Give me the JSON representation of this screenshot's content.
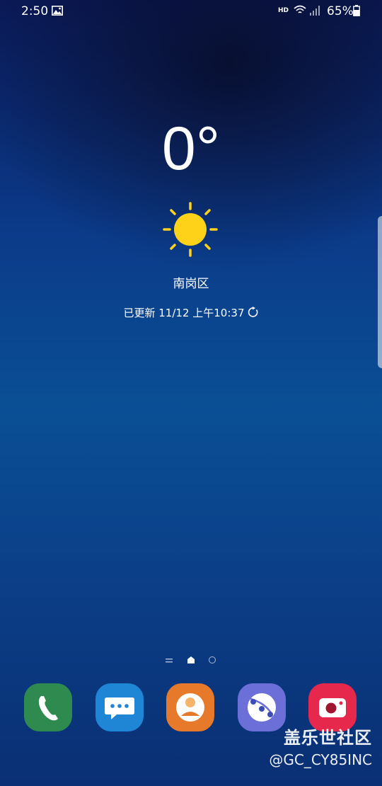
{
  "status_bar": {
    "time": "2:50",
    "network_label": "HD",
    "battery_percent": "65%",
    "icons": [
      "gallery-icon",
      "wifi-icon",
      "signal-icon",
      "battery-icon"
    ]
  },
  "weather_widget": {
    "temperature": "0°",
    "condition_icon": "sun-icon",
    "location": "南岗区",
    "updated": "已更新 11/12 上午10:37",
    "refresh_icon": "refresh-icon",
    "sun_color": "#FFD21A"
  },
  "page_indicator": {
    "items": [
      "pages-list-icon",
      "home-page-icon",
      "page-dot"
    ],
    "active": "home-page-icon"
  },
  "dock": {
    "apps": [
      {
        "name": "phone",
        "icon": "phone-icon",
        "color": "#2F8A4F"
      },
      {
        "name": "messages",
        "icon": "messages-icon",
        "color": "#1F86D6"
      },
      {
        "name": "contacts",
        "icon": "contacts-icon",
        "color": "#E67A2A"
      },
      {
        "name": "internet",
        "icon": "internet-icon",
        "color": "#6D6FD9"
      },
      {
        "name": "camera",
        "icon": "camera-icon",
        "color": "#E5284C"
      }
    ]
  },
  "watermark": {
    "line1": "盖乐世社区",
    "line2": "@GC_CY85INC"
  }
}
